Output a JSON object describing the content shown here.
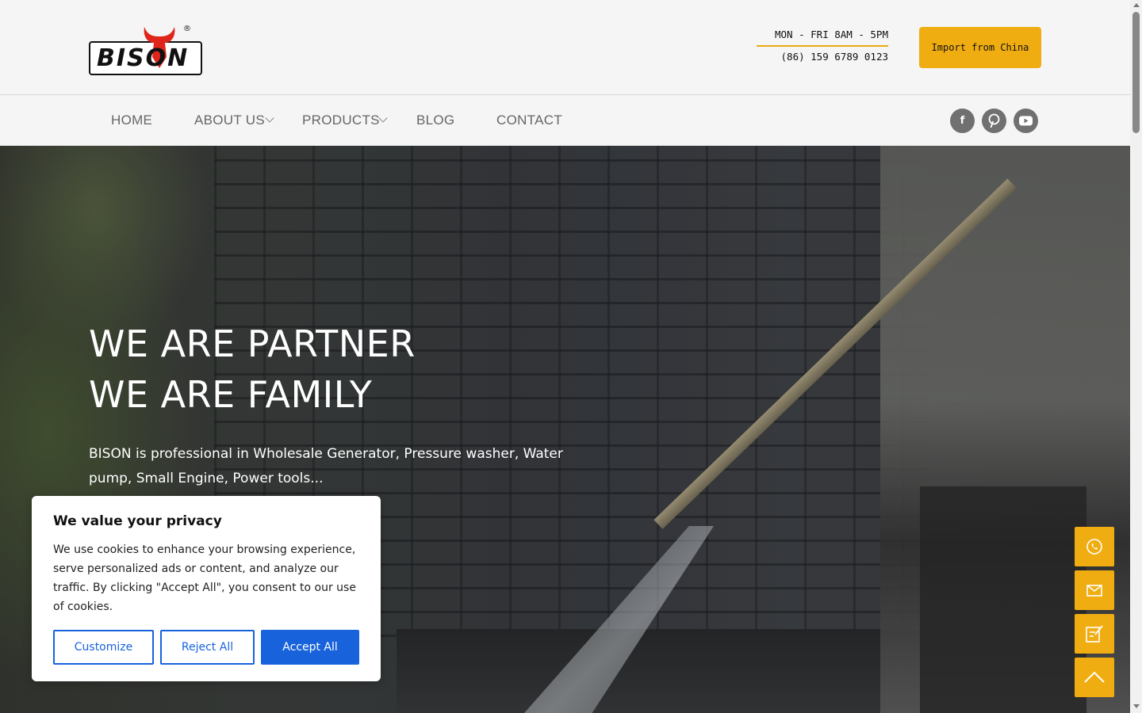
{
  "header": {
    "logo_text": "BISON",
    "logo_reg": "®",
    "hours": "MON - FRI 8AM - 5PM",
    "phone": "(86) 159 6789 0123",
    "import_button": "Import from China"
  },
  "nav": {
    "items": [
      {
        "label": "HOME"
      },
      {
        "label": "ABOUT US"
      },
      {
        "label": "PRODUCTS"
      },
      {
        "label": "BLOG"
      },
      {
        "label": "CONTACT"
      }
    ],
    "social": [
      {
        "name": "facebook-icon",
        "glyph": "f"
      },
      {
        "name": "pinterest-icon",
        "glyph": "P"
      },
      {
        "name": "youtube-icon",
        "glyph": "▶"
      }
    ]
  },
  "hero": {
    "title_line1": "WE ARE PARTNER",
    "title_line2": "WE ARE FAMILY",
    "description": "BISON is professional in Wholesale Generator, Pressure washer, Water pump, Small Engine, Power tools..."
  },
  "floating": [
    "whatsapp-icon",
    "mail-icon",
    "edit-form-icon",
    "scroll-top-icon"
  ],
  "cookie": {
    "title": "We value your privacy",
    "text": "We use cookies to enhance your browsing experience, serve personalized ads or content, and analyze our traffic. By clicking \"Accept All\", you consent to our use of cookies.",
    "customize": "Customize",
    "reject": "Reject All",
    "accept": "Accept All"
  },
  "colors": {
    "accent": "#f0ad12",
    "cookie_blue": "#1863dc"
  }
}
